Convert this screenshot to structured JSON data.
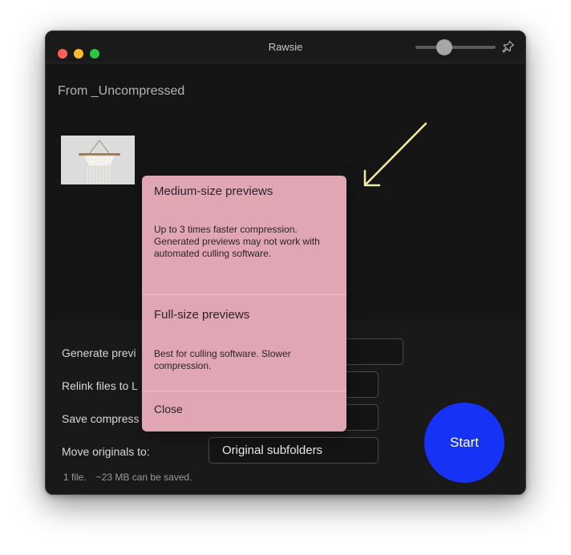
{
  "window": {
    "title": "Rawsie",
    "controls": [
      "close",
      "minimize",
      "zoom"
    ],
    "zoom_slider_level": 0.36
  },
  "source": {
    "label": "From _Uncompressed"
  },
  "settings": {
    "generate_previews_label": "Generate previ",
    "relink_label": "Relink files to L",
    "save_compressed_label": "Save compress",
    "move_originals_label": "Move originals to:",
    "move_originals_value": "Original subfolders"
  },
  "status": {
    "file_count": "1 file.",
    "savings": "~23 MB can be saved."
  },
  "start_button": {
    "label": "Start",
    "color": "#1632f5"
  },
  "popup_menu": {
    "options": [
      {
        "title": "Medium-size previews",
        "description": "Up to 3 times faster compression. Generated previews may not work with automated culling software."
      },
      {
        "title": "Full-size previews",
        "description": "Best for culling software. Slower compression."
      }
    ],
    "close_label": "Close",
    "background_color": "#e0a6b4"
  },
  "annotation": {
    "arrow_color": "#f3eba0"
  }
}
